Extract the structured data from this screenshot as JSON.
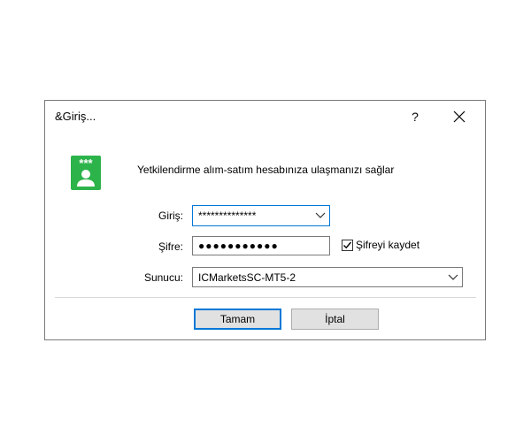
{
  "dialog": {
    "title": "&Giriş...",
    "help_symbol": "?",
    "description": "Yetkilendirme alım-satım hesabınıza ulaşmanızı sağlar",
    "login": {
      "label": "Giriş:",
      "value": "**************"
    },
    "password": {
      "label": "Şifre:",
      "value": "●●●●●●●●●●●"
    },
    "save_password": {
      "label": "Şifreyi kaydet",
      "checked": true
    },
    "server": {
      "label": "Sunucu:",
      "value": "ICMarketsSC-MT5-2"
    },
    "buttons": {
      "ok": "Tamam",
      "cancel": "İptal"
    },
    "icon_stars": "***"
  },
  "colors": {
    "icon_green": "#2cb34a",
    "focus_blue": "#0078d7",
    "button_face": "#e1e1e1"
  },
  "icons": {
    "app": "user-key-icon",
    "close": "close-icon",
    "help": "help-icon",
    "dropdown": "chevron-down-icon",
    "checkbox": "checkmark-icon"
  }
}
